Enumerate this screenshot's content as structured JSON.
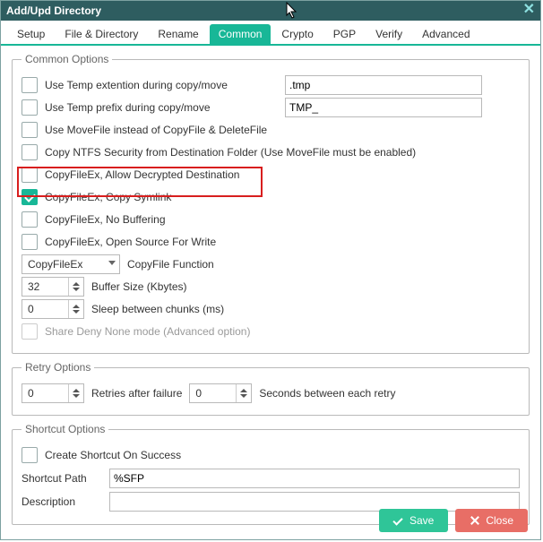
{
  "window": {
    "title": "Add/Upd Directory"
  },
  "tabs": [
    "Setup",
    "File & Directory",
    "Rename",
    "Common",
    "Crypto",
    "PGP",
    "Verify",
    "Advanced"
  ],
  "active_tab_index": 3,
  "common": {
    "legend": "Common Options",
    "opts": {
      "tmp_ext": {
        "label": "Use Temp extention during copy/move",
        "checked": false,
        "value": ".tmp"
      },
      "tmp_pre": {
        "label": "Use Temp prefix during copy/move",
        "checked": false,
        "value": "TMP_"
      },
      "movefile": {
        "label": "Use MoveFile instead of CopyFile & DeleteFile",
        "checked": false
      },
      "ntfs": {
        "label": "Copy NTFS Security from Destination Folder (Use MoveFile must be enabled)",
        "checked": false
      },
      "decrypt": {
        "label": "CopyFileEx, Allow Decrypted Destination",
        "checked": false
      },
      "symlink": {
        "label": "CopyFileEx, Copy Symlink",
        "checked": true
      },
      "nobuf": {
        "label": "CopyFileEx, No Buffering",
        "checked": false
      },
      "opensrc": {
        "label": "CopyFileEx, Open Source For Write",
        "checked": false
      },
      "share": {
        "label": "Share Deny None mode (Advanced option)",
        "checked": false,
        "disabled": true
      }
    },
    "copyfunc": {
      "value": "CopyFileEx",
      "label": "CopyFile Function"
    },
    "bufsize": {
      "value": "32",
      "label": "Buffer Size (Kbytes)"
    },
    "sleep": {
      "value": "0",
      "label": "Sleep between chunks (ms)"
    }
  },
  "retry": {
    "legend": "Retry Options",
    "retries_value": "0",
    "retries_label": "Retries after failure",
    "seconds_value": "0",
    "seconds_label": "Seconds between each retry"
  },
  "shortcut": {
    "legend": "Shortcut Options",
    "create": {
      "label": "Create Shortcut On Success",
      "checked": false
    },
    "path_label": "Shortcut Path",
    "path_value": "%SFP",
    "desc_label": "Description",
    "desc_value": ""
  },
  "footer": {
    "save": "Save",
    "close": "Close"
  }
}
